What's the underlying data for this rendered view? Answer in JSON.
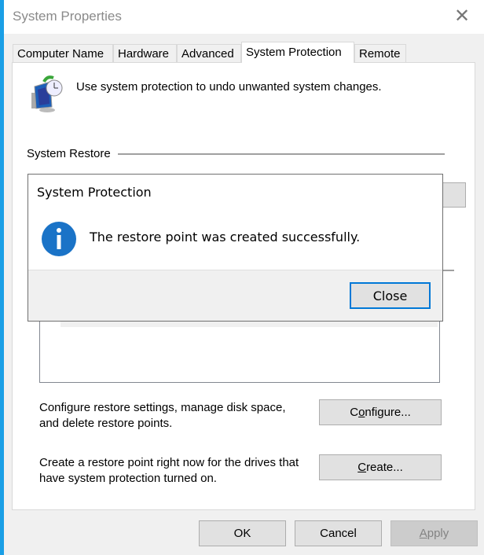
{
  "window": {
    "title": "System Properties"
  },
  "tabs": [
    {
      "label": "Computer Name"
    },
    {
      "label": "Hardware"
    },
    {
      "label": "Advanced"
    },
    {
      "label": "System Protection",
      "active": true
    },
    {
      "label": "Remote"
    }
  ],
  "panel": {
    "intro": "Use system protection to undo unwanted system changes.",
    "system_restore_heading": "System Restore",
    "configure_text_1": "Configure restore settings, manage disk space,",
    "configure_text_2": "and delete restore points.",
    "configure_button": {
      "pre": "C",
      "key": "o",
      "post": "nfigure..."
    },
    "create_text_1": "Create a restore point right now for the drives that",
    "create_text_2": "have system protection turned on.",
    "create_button": {
      "pre": "",
      "key": "C",
      "post": "reate..."
    }
  },
  "dialog": {
    "title": "System Protection",
    "message": "The restore point was created successfully.",
    "close_label": "Close",
    "icon": "info-icon"
  },
  "footer": {
    "ok": "OK",
    "cancel": "Cancel",
    "apply": {
      "pre": "",
      "key": "A",
      "post": "pply"
    },
    "apply_disabled": true
  },
  "colors": {
    "accent": "#0078d7",
    "info": "#1a73c7"
  }
}
